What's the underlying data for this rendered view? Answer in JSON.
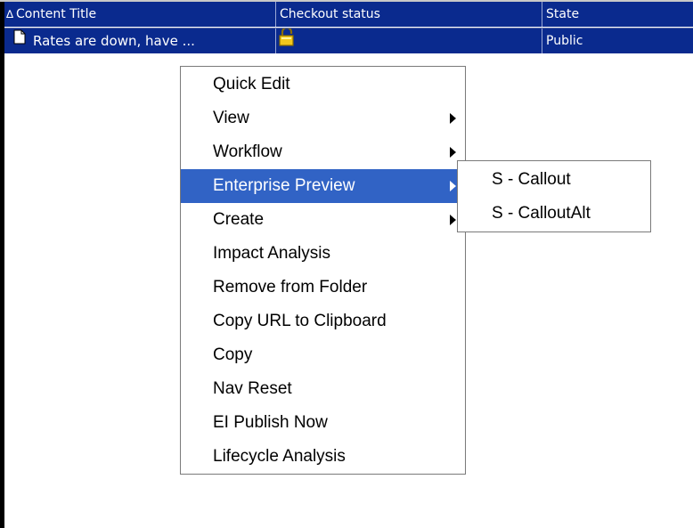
{
  "table": {
    "columns": [
      "Content Title",
      "Checkout status",
      "State"
    ],
    "sort_icon": "∆",
    "rows": [
      {
        "title": "Rates are down, have ...",
        "checkout_status_icon": "lock-icon",
        "state": "Public"
      }
    ]
  },
  "context_menu": {
    "items": [
      {
        "label": "Quick Edit",
        "submenu": false
      },
      {
        "label": "View",
        "submenu": true
      },
      {
        "label": "Workflow",
        "submenu": true
      },
      {
        "label": "Enterprise Preview",
        "submenu": true,
        "selected": true
      },
      {
        "label": "Create",
        "submenu": true
      },
      {
        "label": "Impact Analysis",
        "submenu": false
      },
      {
        "label": "Remove from Folder",
        "submenu": false
      },
      {
        "label": "Copy URL to Clipboard",
        "submenu": false
      },
      {
        "label": "Copy",
        "submenu": false
      },
      {
        "label": "Nav Reset",
        "submenu": false
      },
      {
        "label": "EI Publish Now",
        "submenu": false
      },
      {
        "label": "Lifecycle Analysis",
        "submenu": false
      }
    ]
  },
  "submenu": {
    "items": [
      {
        "label": "S - Callout"
      },
      {
        "label": "S - CalloutAlt"
      }
    ]
  },
  "colors": {
    "header_bg": "#0a2a8e",
    "selection": "#3163c5",
    "menu_bg": "#ffffff"
  }
}
